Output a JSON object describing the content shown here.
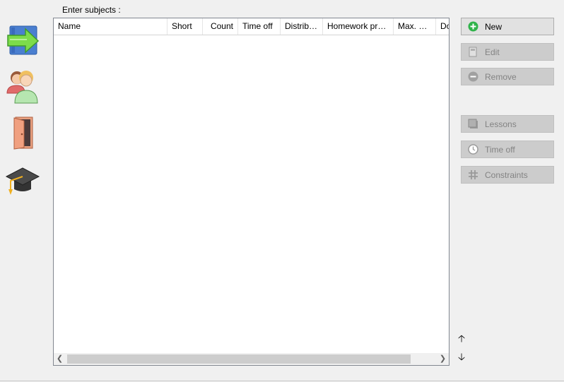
{
  "prompt_label": "Enter subjects :",
  "sidebar": [
    {
      "name": "subjects",
      "icon": "arrow-into-book-icon"
    },
    {
      "name": "teachers",
      "icon": "people-icon"
    },
    {
      "name": "classrooms",
      "icon": "door-icon"
    },
    {
      "name": "classes",
      "icon": "graduation-cap-icon"
    }
  ],
  "table": {
    "columns": [
      "Name",
      "Short",
      "Count",
      "Time off",
      "Distribut...",
      "Homework prep...",
      "Max. on...",
      "Do"
    ],
    "rows": []
  },
  "buttons": {
    "new": "New",
    "edit": "Edit",
    "remove": "Remove",
    "lessons": "Lessons",
    "time_off": "Time off",
    "constraints": "Constraints"
  },
  "colors": {
    "accent_green": "#2fb34a",
    "arrow_green": "#7ddc4a",
    "book_blue": "#4a7fd0"
  }
}
